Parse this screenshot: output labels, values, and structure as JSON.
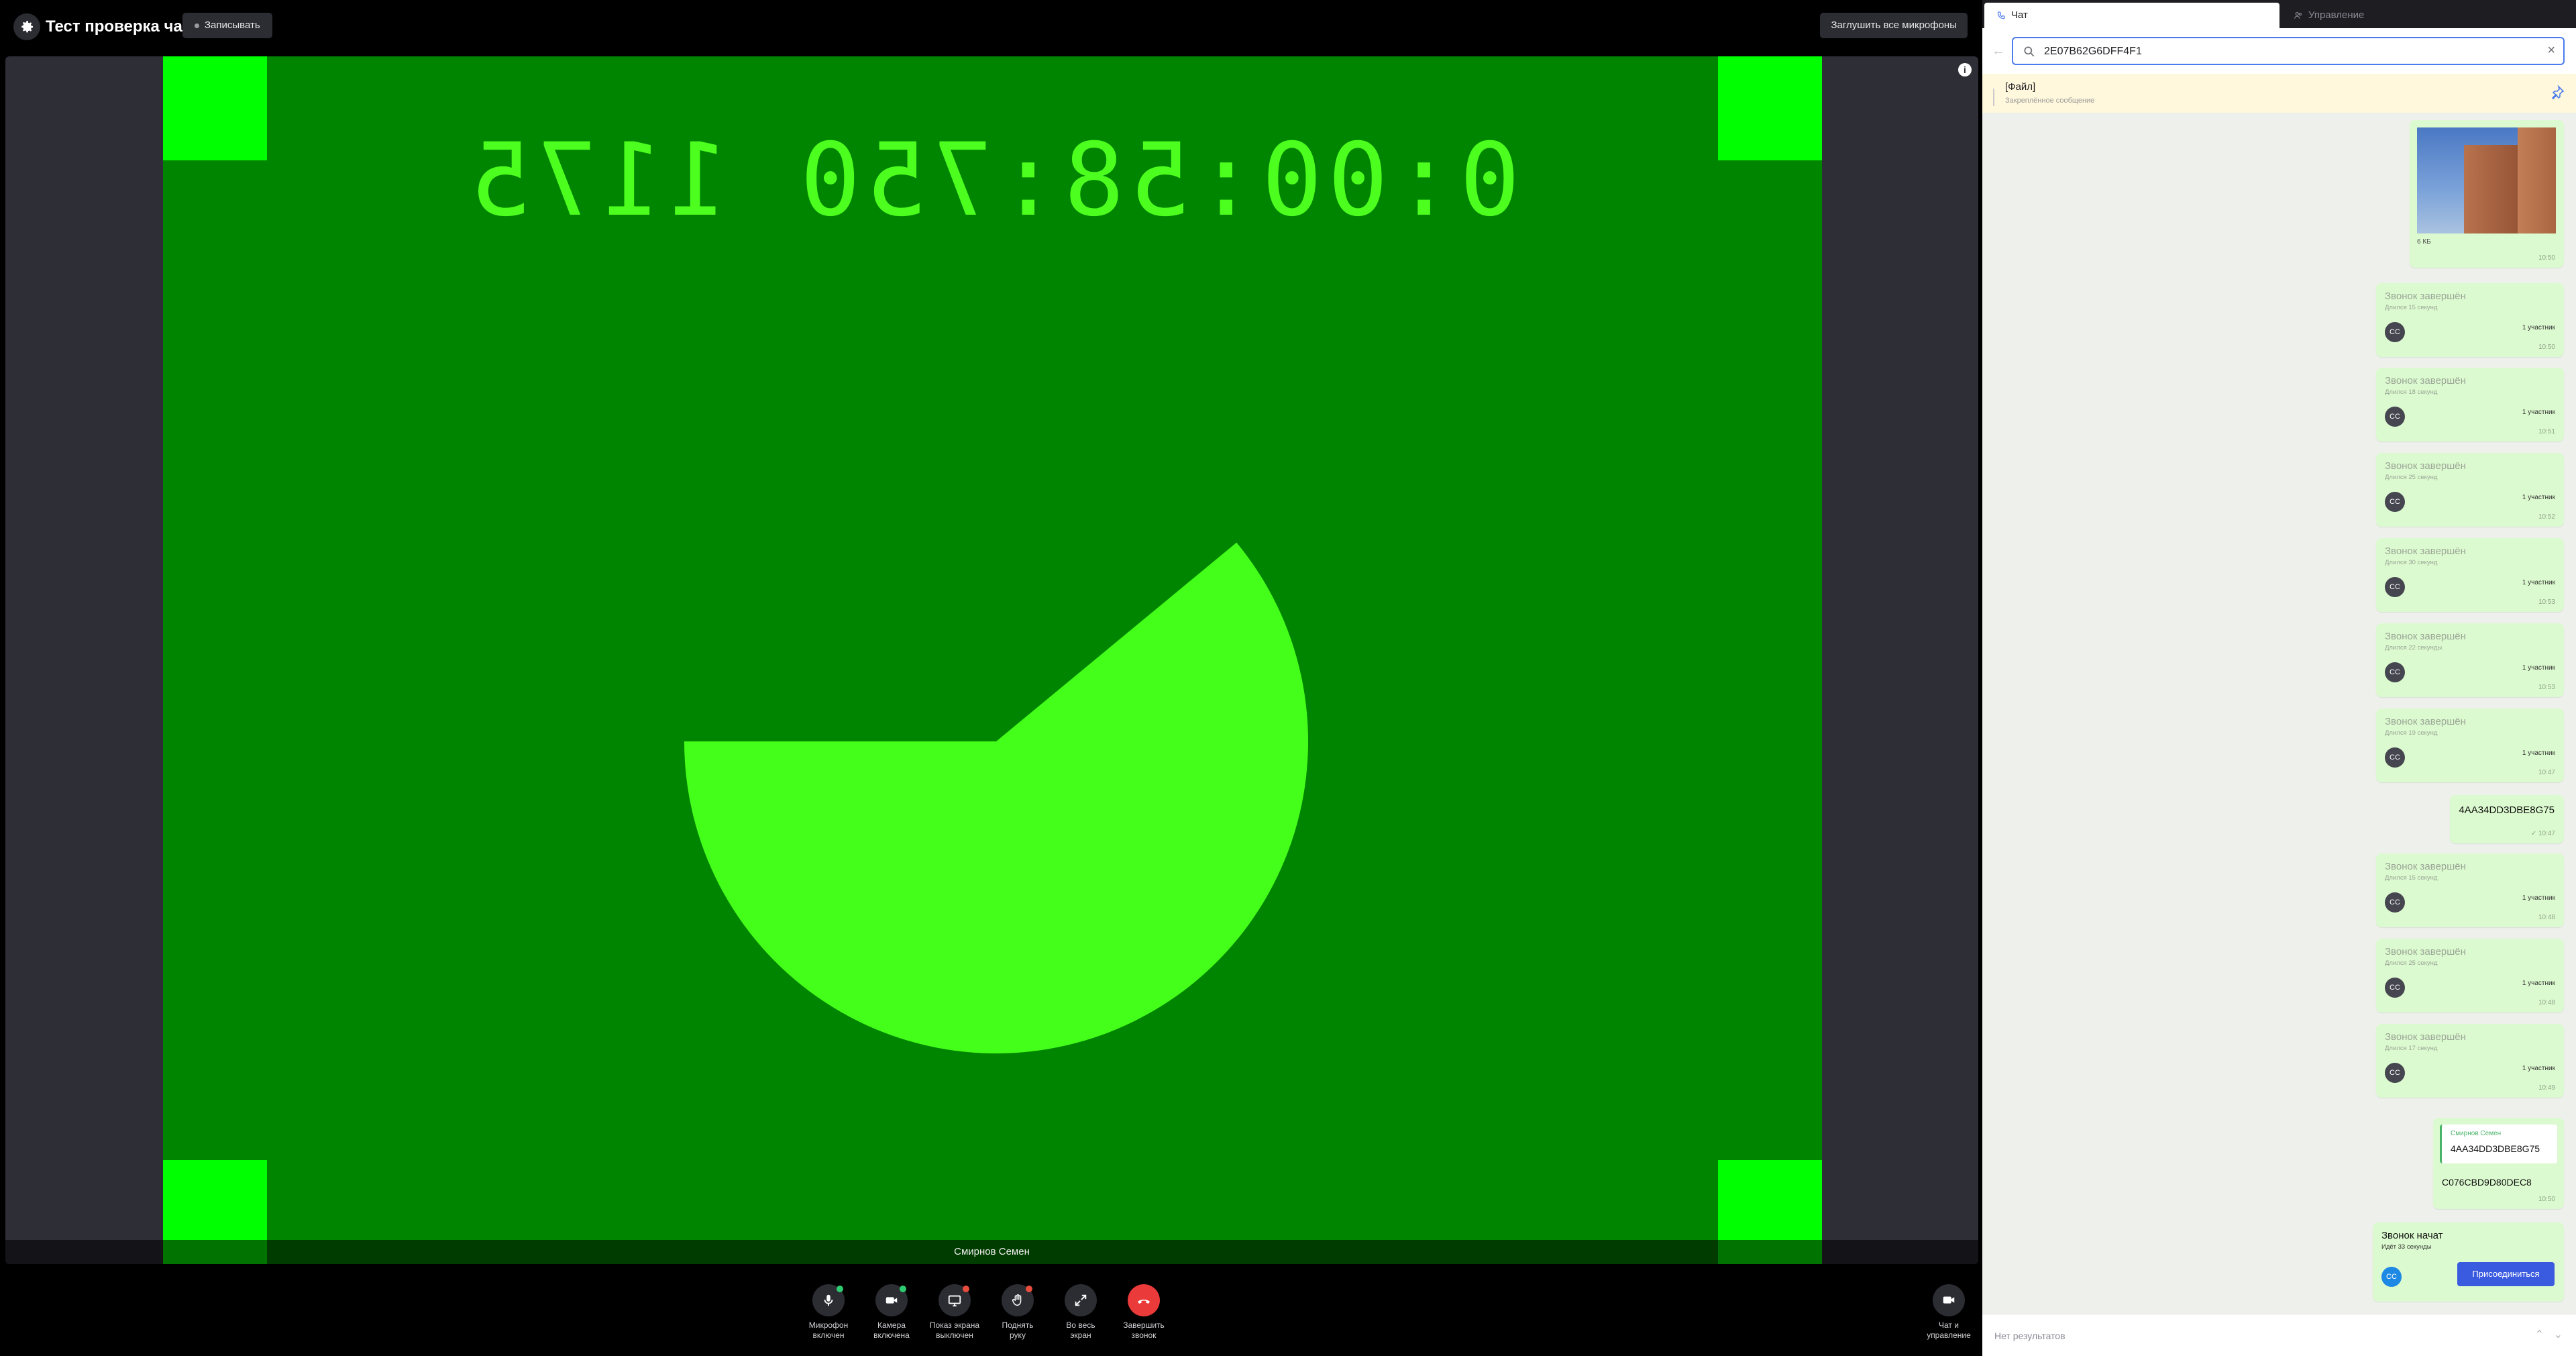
{
  "header": {
    "title": "Тест проверка чат",
    "record_label": "Записывать",
    "mute_all_label": "Заглушить все микрофоны"
  },
  "video": {
    "timecode": "0:00:58:750 1175",
    "participant_name": "Смирнов Семен",
    "info_icon": "i",
    "progress_fraction": 0.39
  },
  "controls": [
    {
      "icon": "microphone-icon",
      "line1": "Микрофон",
      "line2": "включен",
      "badge_color": "#2ecc71"
    },
    {
      "icon": "camera-icon",
      "line1": "Камера",
      "line2": "включена",
      "badge_color": "#2ecc71"
    },
    {
      "icon": "screen-share-icon",
      "line1": "Показ экрана",
      "line2": "выключен",
      "badge_color": "#e74c3c"
    },
    {
      "icon": "hand-icon",
      "line1": "Поднять",
      "line2": "руку",
      "badge_color": "#e74c3c"
    },
    {
      "icon": "fullscreen-icon",
      "line1": "Во весь",
      "line2": "экран",
      "badge_color": ""
    },
    {
      "icon": "hangup-icon",
      "line1": "Завершить",
      "line2": "звонок",
      "badge_color": ""
    }
  ],
  "chat_toggle": {
    "line1": "Чат и",
    "line2": "управление"
  },
  "panel": {
    "tabs": {
      "chat": "Чат",
      "manage": "Управление"
    },
    "search": {
      "value": "2E07B62G6DFF4F1"
    },
    "pinned": {
      "title": "[Файл]",
      "subtitle": "Закреплённое сообщение"
    },
    "image_message": {
      "size": "6 КБ",
      "time": "10:50"
    },
    "call_cards": [
      {
        "title": "Звонок завершён",
        "duration": "Длился 15 секунд",
        "avatar": "СС",
        "participants": "1 участник",
        "time": "10:50"
      },
      {
        "title": "Звонок завершён",
        "duration": "Длился 18 секунд",
        "avatar": "СС",
        "participants": "1 участник",
        "time": "10:51"
      },
      {
        "title": "Звонок завершён",
        "duration": "Длился 25 секунд",
        "avatar": "СС",
        "participants": "1 участник",
        "time": "10:52"
      },
      {
        "title": "Звонок завершён",
        "duration": "Длился 30 секунд",
        "avatar": "СС",
        "participants": "1 участник",
        "time": "10:53"
      },
      {
        "title": "Звонок завершён",
        "duration": "Длился 22 секунды",
        "avatar": "СС",
        "participants": "1 участник",
        "time": "10:53"
      },
      {
        "title": "Звонок завершён",
        "duration": "Длился 19 секунд",
        "avatar": "СС",
        "participants": "1 участник",
        "time": "10:47"
      },
      {
        "title": "Звонок завершён",
        "duration": "Длился 15 секунд",
        "avatar": "СС",
        "participants": "1 участник",
        "time": "10:48"
      },
      {
        "title": "Звонок завершён",
        "duration": "Длился 25 секунд",
        "avatar": "СС",
        "participants": "1 участник",
        "time": "10:48"
      },
      {
        "title": "Звонок завершён",
        "duration": "Длился 17 секунд",
        "avatar": "СС",
        "participants": "1 участник",
        "time": "10:49"
      }
    ],
    "text_message": {
      "text": "4AA34DD3DBE8G75",
      "time": "✓ 10:47"
    },
    "reply_message": {
      "quote_author": "Смирнов Семен",
      "quote_text": "4AA34DD3DBE8G75",
      "text": "C076CBD9D80DEC8",
      "time": "10:50"
    },
    "active_call": {
      "title": "Звонок начат",
      "duration": "Идёт 33 секунды",
      "avatar": "СС",
      "join_label": "Присоединиться"
    },
    "results": {
      "label": "Нет результатов"
    }
  }
}
